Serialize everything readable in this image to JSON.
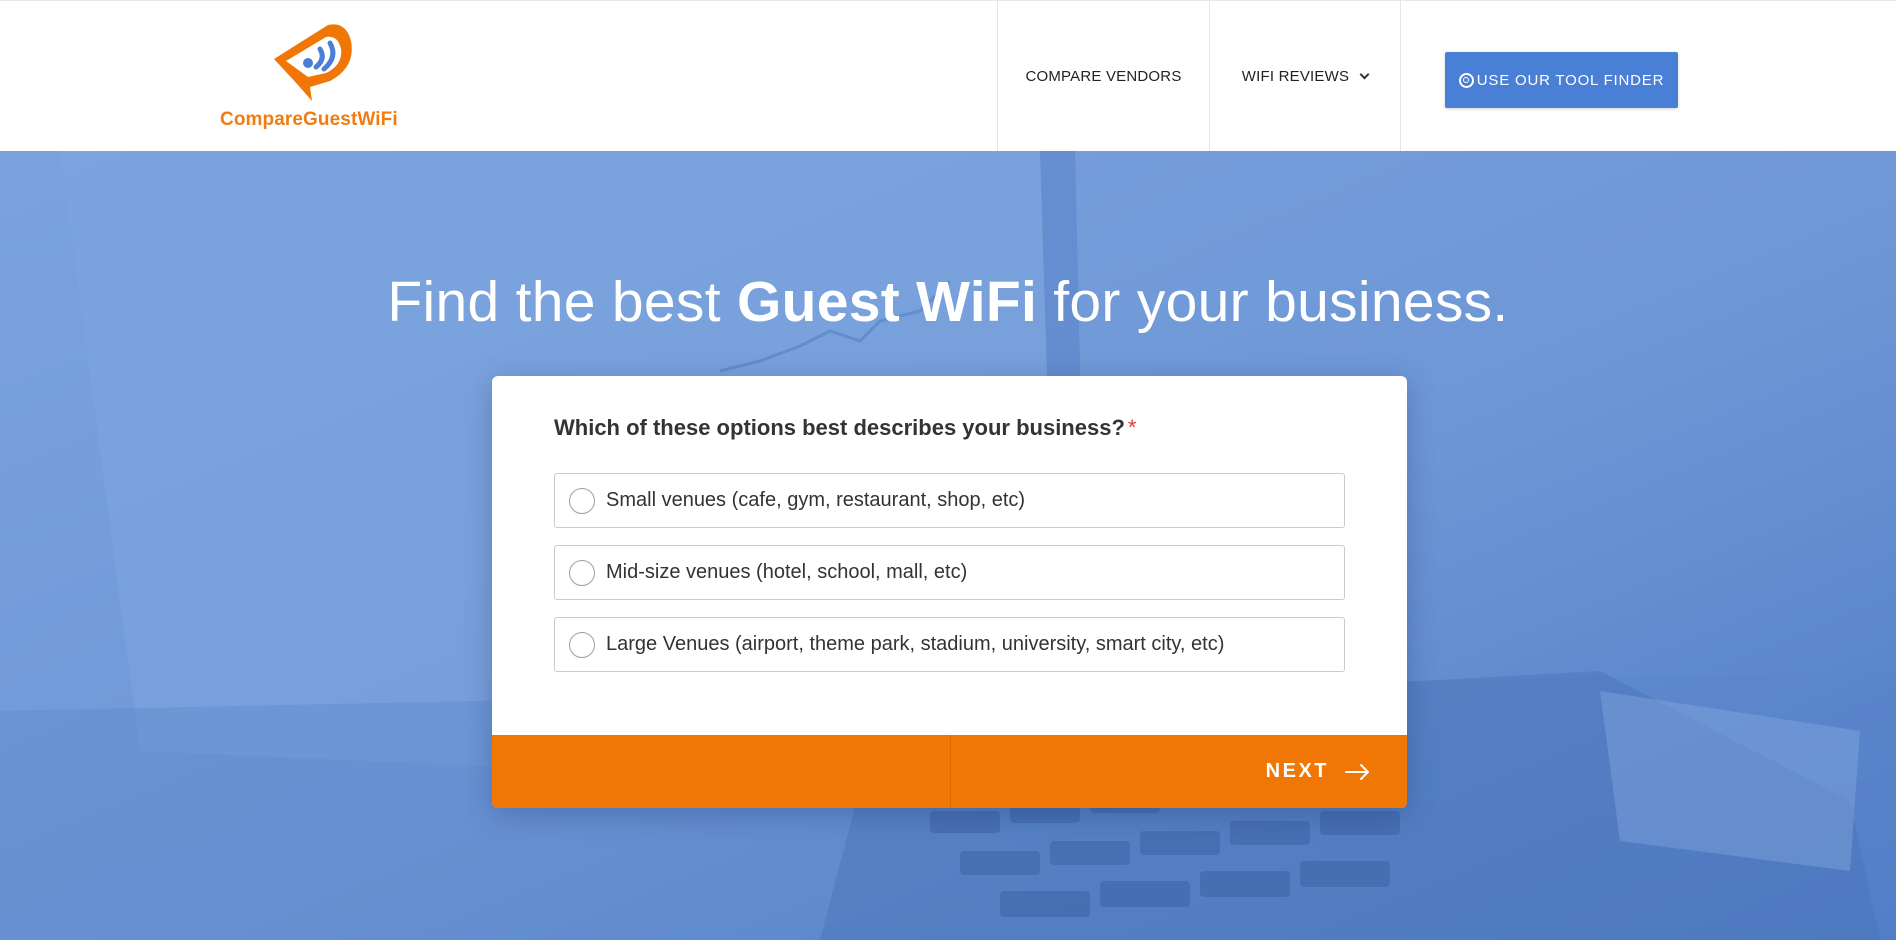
{
  "header": {
    "logo_text": "CompareGuestWiFi",
    "nav": {
      "compare_vendors": "COMPARE VENDORS",
      "wifi_reviews": "WIFI REVIEWS"
    },
    "tool_finder_label": "USE OUR TOOL FINDER"
  },
  "hero": {
    "title_prefix": "Find the best ",
    "title_bold": "Guest WiFi",
    "title_suffix": " for your business."
  },
  "form": {
    "question": "Which of these options best describes your business?",
    "required_mark": "*",
    "options": [
      {
        "label": "Small venues (cafe, gym, restaurant, shop, etc)",
        "selected": false
      },
      {
        "label": "Mid-size venues (hotel, school, mall, etc)",
        "selected": false
      },
      {
        "label": "Large Venues (airport, theme park, stadium, university, smart city, etc)",
        "selected": false
      }
    ],
    "next_label": "NEXT"
  },
  "colors": {
    "brand_orange": "#f07706",
    "brand_blue": "#4a7fd6",
    "hero_blue": "#6b97d8"
  },
  "icons": [
    "wifi-chat-logo",
    "chevron-down-icon",
    "target-icon",
    "arrow-right-icon"
  ]
}
